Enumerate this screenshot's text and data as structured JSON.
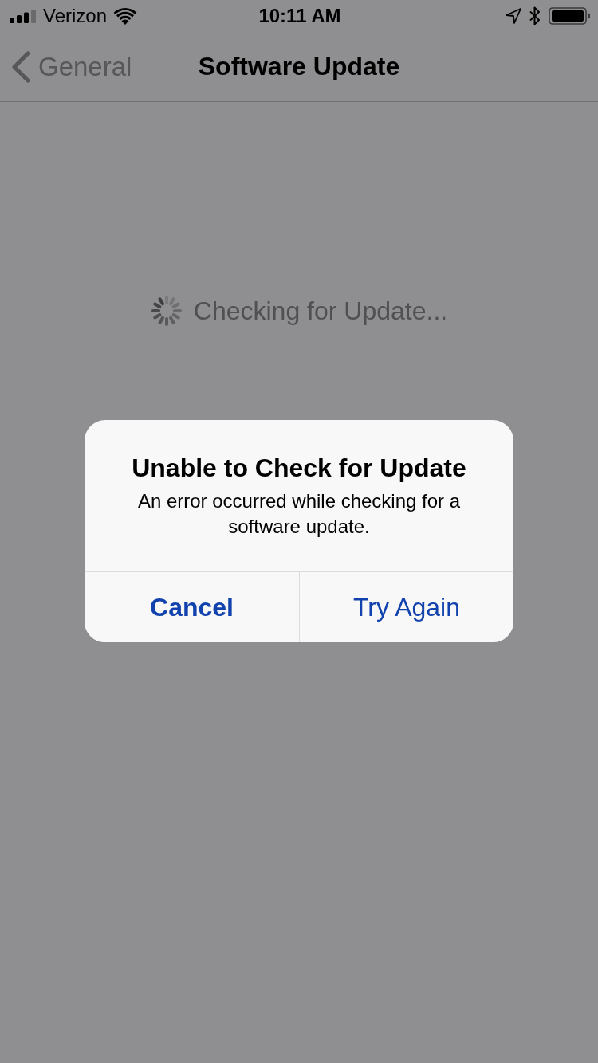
{
  "status_bar": {
    "carrier": "Verizon",
    "time": "10:11 AM"
  },
  "nav_bar": {
    "back_label": "General",
    "title": "Software Update"
  },
  "status_message": "Checking for Update...",
  "alert": {
    "title": "Unable to Check for Update",
    "message": "An error occurred while checking for a software update.",
    "buttons": [
      {
        "label": "Cancel",
        "kind": "cancel"
      },
      {
        "label": "Try Again",
        "kind": "default"
      }
    ]
  }
}
